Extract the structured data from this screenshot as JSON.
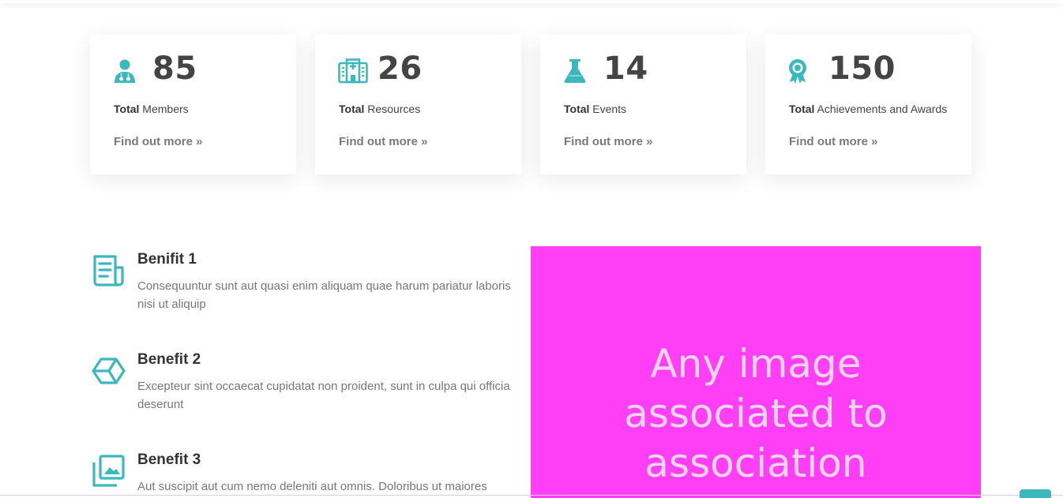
{
  "colors": {
    "accent": "#3ab8bd",
    "image_placeholder": "#ff3ef5",
    "image_text": "#f2d6ee"
  },
  "stats": [
    {
      "icon": "doctor-icon",
      "count": "85",
      "label_bold": "Total",
      "label_rest": " Members",
      "link": "Find out more »"
    },
    {
      "icon": "hospital-icon",
      "count": "26",
      "label_bold": "Total",
      "label_rest": " Resources",
      "link": "Find out more »"
    },
    {
      "icon": "flask-icon",
      "count": "14",
      "label_bold": "Total",
      "label_rest": " Events",
      "link": "Find out more »"
    },
    {
      "icon": "award-icon",
      "count": "150",
      "label_bold": "Total",
      "label_rest": " Achievements and Awards",
      "link": "Find out more »"
    }
  ],
  "benefits": [
    {
      "icon": "newspaper-icon",
      "title": "Benifit 1",
      "desc": "Consequuntur sunt aut quasi enim aliquam quae harum pariatur laboris nisi ut aliquip"
    },
    {
      "icon": "cube-icon",
      "title": "Benefit 2",
      "desc": "Excepteur sint occaecat cupidatat non proident, sunt in culpa qui officia deserunt"
    },
    {
      "icon": "images-icon",
      "title": "Benefit 3",
      "desc": "Aut suscipit aut cum nemo deleniti aut omnis. Doloribus ut maiores omnis facere"
    }
  ],
  "image_block": {
    "text": "Any image associated to association"
  }
}
